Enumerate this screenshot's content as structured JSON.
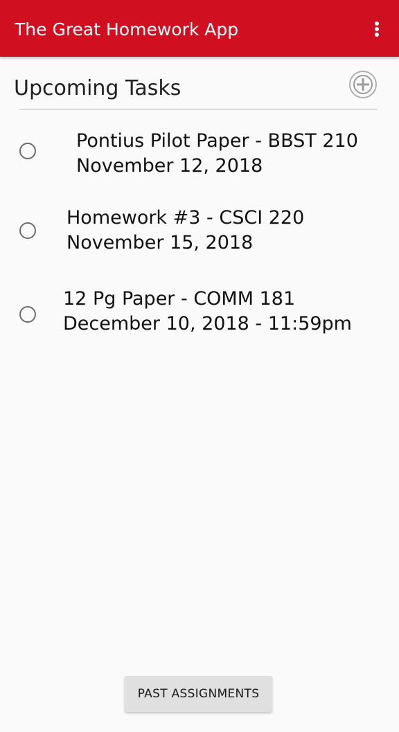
{
  "app_bar": {
    "title": "The Great Homework App",
    "overflow_icon": "more-vert-icon",
    "background_color": "#d01020"
  },
  "header": {
    "title": "Upcoming Tasks",
    "add_icon": "add-circle-icon"
  },
  "tasks": [
    {
      "title": "Pontius Pilot Paper - BBST 210",
      "due": "November 12, 2018",
      "checked": false
    },
    {
      "title": "Homework #3 - CSCI 220",
      "due": "November 15, 2018",
      "checked": false
    },
    {
      "title": "12 Pg Paper - COMM 181",
      "due": "December 10, 2018 - 11:59pm",
      "checked": false
    }
  ],
  "footer": {
    "past_button_label": "PAST ASSIGNMENTS"
  }
}
